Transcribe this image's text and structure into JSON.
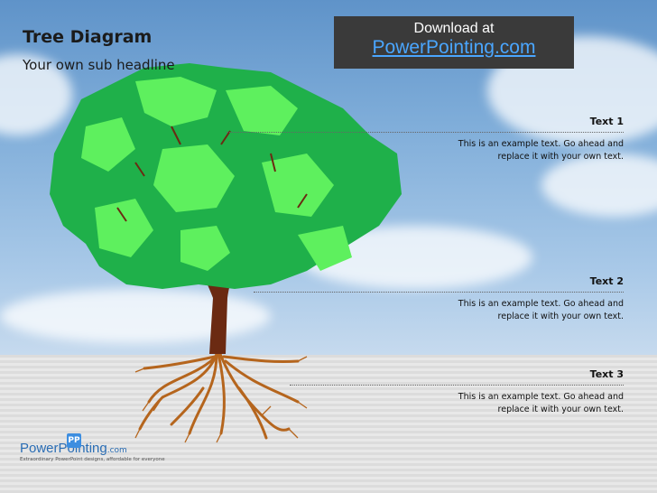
{
  "slide": {
    "title": "Tree Diagram",
    "subtitle": "Your own sub headline"
  },
  "banner": {
    "line1": "Download at",
    "line2": "PowerPointing.com"
  },
  "callouts": [
    {
      "heading": "Text 1",
      "text_line1": "This is an example text. Go ahead and",
      "text_line2": "replace it with your own text."
    },
    {
      "heading": "Text 2",
      "text_line1": "This is an example text. Go ahead and",
      "text_line2": "replace it with your own text."
    },
    {
      "heading": "Text 3",
      "text_line1": "This is an example text. Go ahead and",
      "text_line2": "replace it with your own text."
    }
  ],
  "logo": {
    "badge": "PP",
    "name": "PowerPointing",
    "suffix": ".com",
    "tagline": "Extraordinary PowerPoint designs, affordable for everyone"
  },
  "colors": {
    "banner_bg": "#3a3a3a",
    "banner_link": "#4aa6ff",
    "leaf_dark": "#1fb04a",
    "leaf_light": "#5ef05e",
    "trunk": "#6b2a12",
    "roots": "#b5651d"
  }
}
